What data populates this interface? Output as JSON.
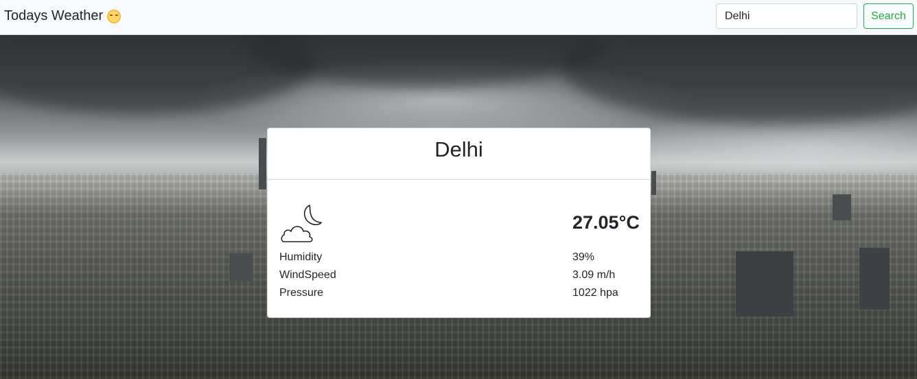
{
  "navbar": {
    "brand": "Todays Weather",
    "brand_icon": "smiling-sun-emoji-icon",
    "search_value": "Delhi",
    "search_label": "Search",
    "accent_color": "#28a745"
  },
  "weather": {
    "city": "Delhi",
    "icon": "moon-cloud-icon",
    "temperature": "27.05°C",
    "details": [
      {
        "label": "Humidity",
        "value": "39%"
      },
      {
        "label": "WindSpeed",
        "value": "3.09 m/h"
      },
      {
        "label": "Pressure",
        "value": "1022 hpa"
      }
    ]
  }
}
